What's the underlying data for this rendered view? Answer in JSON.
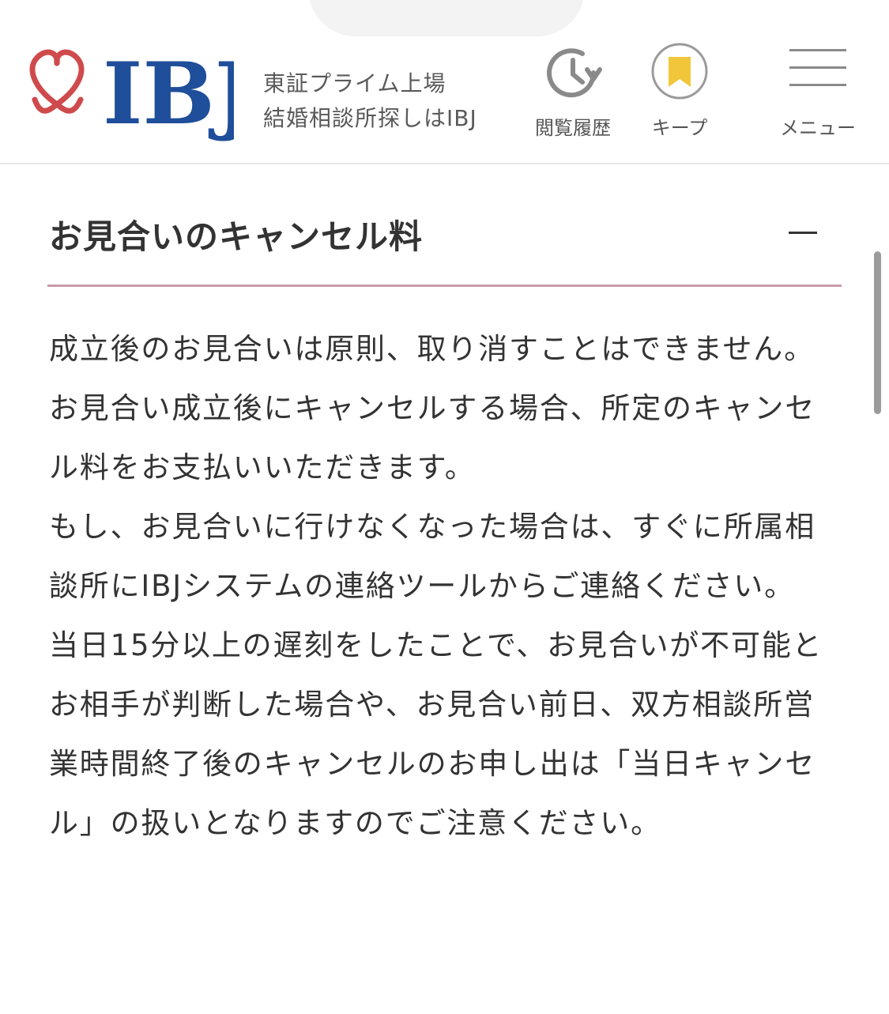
{
  "header": {
    "logo_text": "IBJ",
    "tagline_line1": "東証プライム上場",
    "tagline_line2": "結婚相談所探しはIBJ",
    "history_label": "閲覧履歴",
    "keep_label": "キープ",
    "menu_label": "メニュー"
  },
  "section": {
    "title": "お見合いのキャンセル料",
    "toggle_symbol": "—",
    "paragraphs": [
      "成立後のお見合いは原則、取り消すことはできません。お見合い成立後にキャンセルする場合、所定のキャンセル料をお支払いいただきます。",
      "もし、お見合いに行けなくなった場合は、すぐに所属相談所にIBJシステムの連絡ツールからご連絡ください。",
      "当日15分以上の遅刻をしたことで、お見合いが不可能とお相手が判断した場合や、お見合い前日、双方相談所営業時間終了後のキャンセルのお申し出は「当日キャンセル」の扱いとなりますのでご注意ください。"
    ]
  },
  "colors": {
    "brand_blue": "#1f4e9a",
    "brand_red": "#cf4a4c",
    "keep_yellow": "#f1c63a",
    "divider_pink": "#c99aac",
    "icon_gray": "#8a8a8a"
  }
}
